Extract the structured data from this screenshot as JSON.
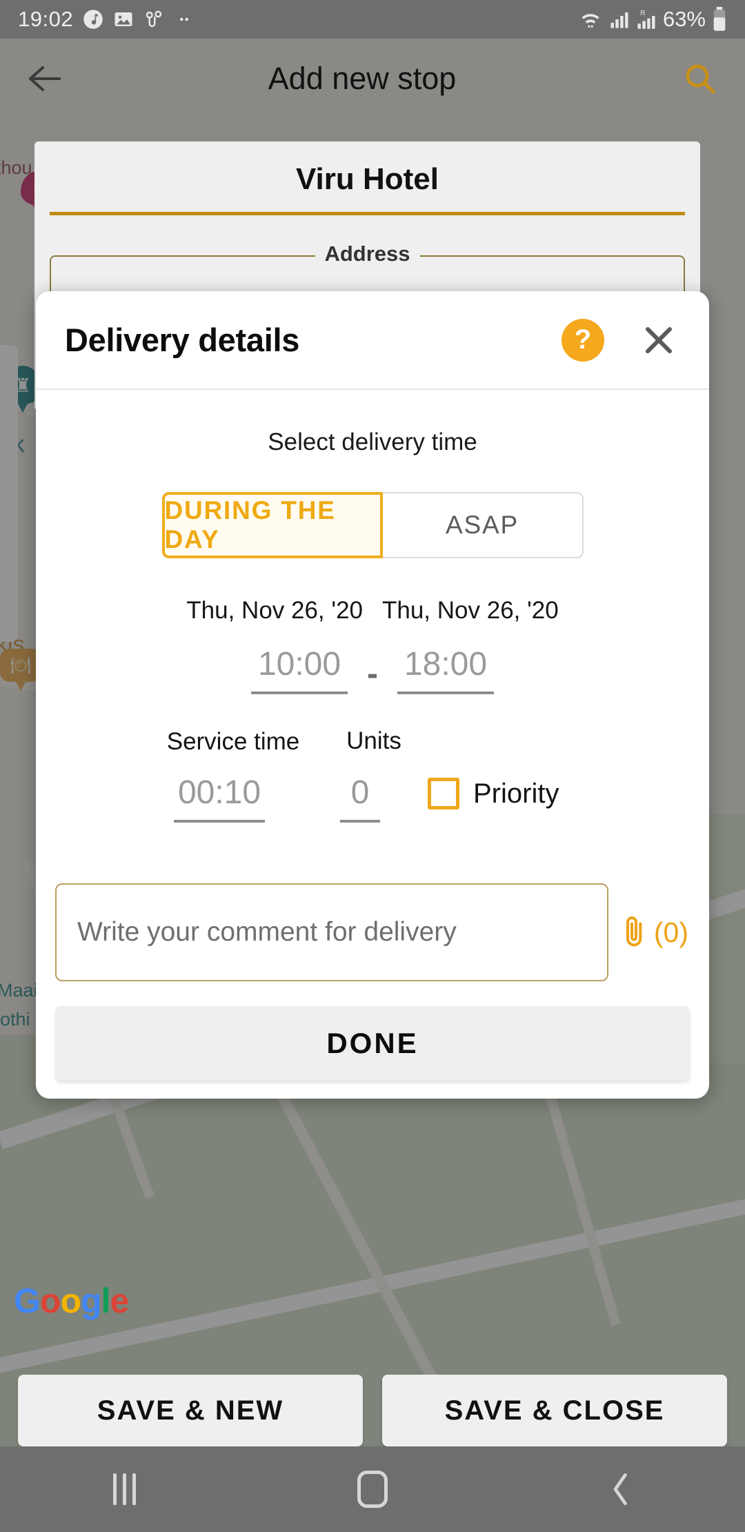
{
  "status_bar": {
    "time": "19:02",
    "battery_percent": "63%",
    "icons": [
      "music-note-icon",
      "image-icon",
      "route-icon",
      "more-dots-icon",
      "wifi-icon",
      "signal-icon",
      "roaming-signal-icon",
      "battery-icon"
    ]
  },
  "app_header": {
    "title": "Add new stop",
    "back_icon": "back-arrow-icon",
    "search_icon": "search-icon"
  },
  "stop_form": {
    "name_value": "Viru Hotel",
    "address_label": "Address"
  },
  "dialog": {
    "title": "Delivery details",
    "help_icon_glyph": "?",
    "close_icon": "close-icon",
    "select_time_label": "Select delivery time",
    "time_modes": [
      {
        "label": "DURING THE DAY",
        "selected": true
      },
      {
        "label": "ASAP",
        "selected": false
      }
    ],
    "date_from": "Thu, Nov 26, '20",
    "date_to": "Thu, Nov 26, '20",
    "time_from": "10:00",
    "time_separator": "-",
    "time_to": "18:00",
    "service_time_label": "Service time",
    "units_label": "Units",
    "service_time_value": "00:10",
    "units_value": "0",
    "priority_label": "Priority",
    "priority_checked": false,
    "comment_placeholder": "Write your comment for delivery",
    "comment_value": "",
    "attachment_icon": "paperclip-icon",
    "attachment_count": "(0)",
    "done_label": "DONE"
  },
  "bottom_actions": {
    "save_new": "SAVE & NEW",
    "save_close": "SAVE & CLOSE"
  },
  "map": {
    "attribution": {
      "g1": "G",
      "o1": "o",
      "o2": "o",
      "g2": "g",
      "l1": "l",
      "e1": "e"
    },
    "labels": [
      {
        "text": "thou",
        "color": "maroon"
      },
      {
        "text": "äik",
        "color": "teal"
      },
      {
        "text": "kis",
        "color": "orange"
      },
      {
        "text": "Maai",
        "color": "teal"
      },
      {
        "text": "lothi",
        "color": "teal"
      }
    ]
  },
  "nav_bar": {
    "recents": "recents-icon",
    "home": "home-icon",
    "back": "back-icon"
  }
}
